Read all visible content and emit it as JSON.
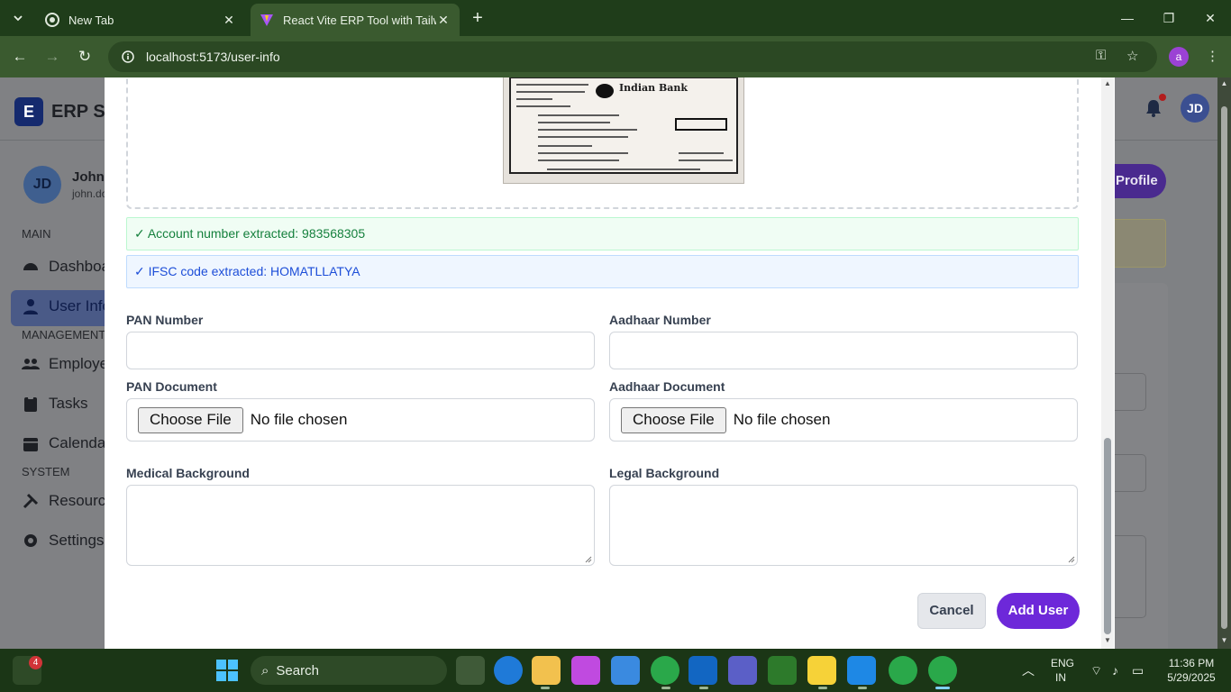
{
  "browser": {
    "tabs": [
      {
        "title": "New Tab",
        "active": false
      },
      {
        "title": "React Vite ERP Tool with Tailwind",
        "active": true
      }
    ],
    "url": "localhost:5173/user-info",
    "profile_initial": "a"
  },
  "app": {
    "logo_letter": "E",
    "logo_text": "ERP Sy",
    "header_avatar": "JD",
    "profile_button": "Profile",
    "user": {
      "initials": "JD",
      "name": "John I",
      "email": "john.do"
    },
    "sidebar": {
      "sections": [
        "MAIN",
        "MANAGEMENT",
        "SYSTEM"
      ],
      "items": [
        {
          "label": "Dashboa",
          "icon": "dashboard-icon"
        },
        {
          "label": "User Info",
          "icon": "user-icon",
          "active": true
        },
        {
          "label": "Employe",
          "icon": "users-icon"
        },
        {
          "label": "Tasks",
          "icon": "clipboard-icon"
        },
        {
          "label": "Calendar",
          "icon": "calendar-icon"
        },
        {
          "label": "Resource",
          "icon": "tools-icon"
        },
        {
          "label": "Settings",
          "icon": "gear-icon"
        }
      ]
    }
  },
  "modal": {
    "document_preview": {
      "bank_name": "Indian Bank"
    },
    "alerts": {
      "account": "✓ Account number extracted: 983568305",
      "ifsc": "✓ IFSC code extracted: HOMATLLATYA"
    },
    "fields": {
      "pan_number": {
        "label": "PAN Number",
        "value": ""
      },
      "aadhaar_number": {
        "label": "Aadhaar Number",
        "value": ""
      },
      "pan_document": {
        "label": "PAN Document",
        "button": "Choose File",
        "status": "No file chosen"
      },
      "aadhaar_document": {
        "label": "Aadhaar Document",
        "button": "Choose File",
        "status": "No file chosen"
      },
      "medical_background": {
        "label": "Medical Background",
        "value": ""
      },
      "legal_background": {
        "label": "Legal Background",
        "value": ""
      }
    },
    "buttons": {
      "cancel": "Cancel",
      "add_user": "Add User"
    }
  },
  "taskbar": {
    "notification_count": "4",
    "search_label": "Search",
    "language": "ENG",
    "region": "IN",
    "time": "11:36 PM",
    "date": "5/29/2025"
  },
  "colors": {
    "accent": "#6d28d9",
    "success_bg": "#f0fdf4",
    "success_text": "#15803d",
    "info_bg": "#eff6ff",
    "info_text": "#1d4ed8",
    "browser_frame": "#1f3d1a"
  }
}
